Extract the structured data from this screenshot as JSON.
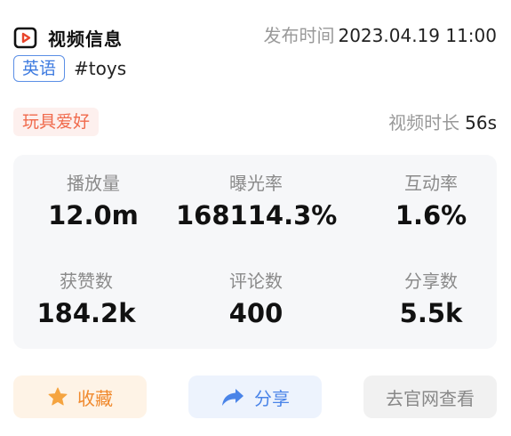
{
  "header": {
    "icon": "video-play-icon",
    "title": "视频信息",
    "publish_label": "发布时间",
    "publish_value": "2023.04.19 11:00"
  },
  "tags": {
    "language": "英语",
    "hashtag": "#toys"
  },
  "category": "玩具爱好",
  "duration": {
    "label": "视频时长",
    "value": "56s"
  },
  "stats": [
    {
      "label": "播放量",
      "value": "12.0m"
    },
    {
      "label": "曝光率",
      "value": "168114.3%"
    },
    {
      "label": "互动率",
      "value": "1.6%"
    },
    {
      "label": "获赞数",
      "value": "184.2k"
    },
    {
      "label": "评论数",
      "value": "400"
    },
    {
      "label": "分享数",
      "value": "5.5k"
    }
  ],
  "actions": {
    "favorite": {
      "label": "收藏",
      "icon": "star-icon"
    },
    "share": {
      "label": "分享",
      "icon": "share-arrow-icon"
    },
    "official_site": {
      "label": "去官网查看"
    }
  },
  "colors": {
    "language_tag": "#3e7be0",
    "category": "#f06a4c",
    "favorite": "#f0892d",
    "share": "#4a84e8"
  }
}
